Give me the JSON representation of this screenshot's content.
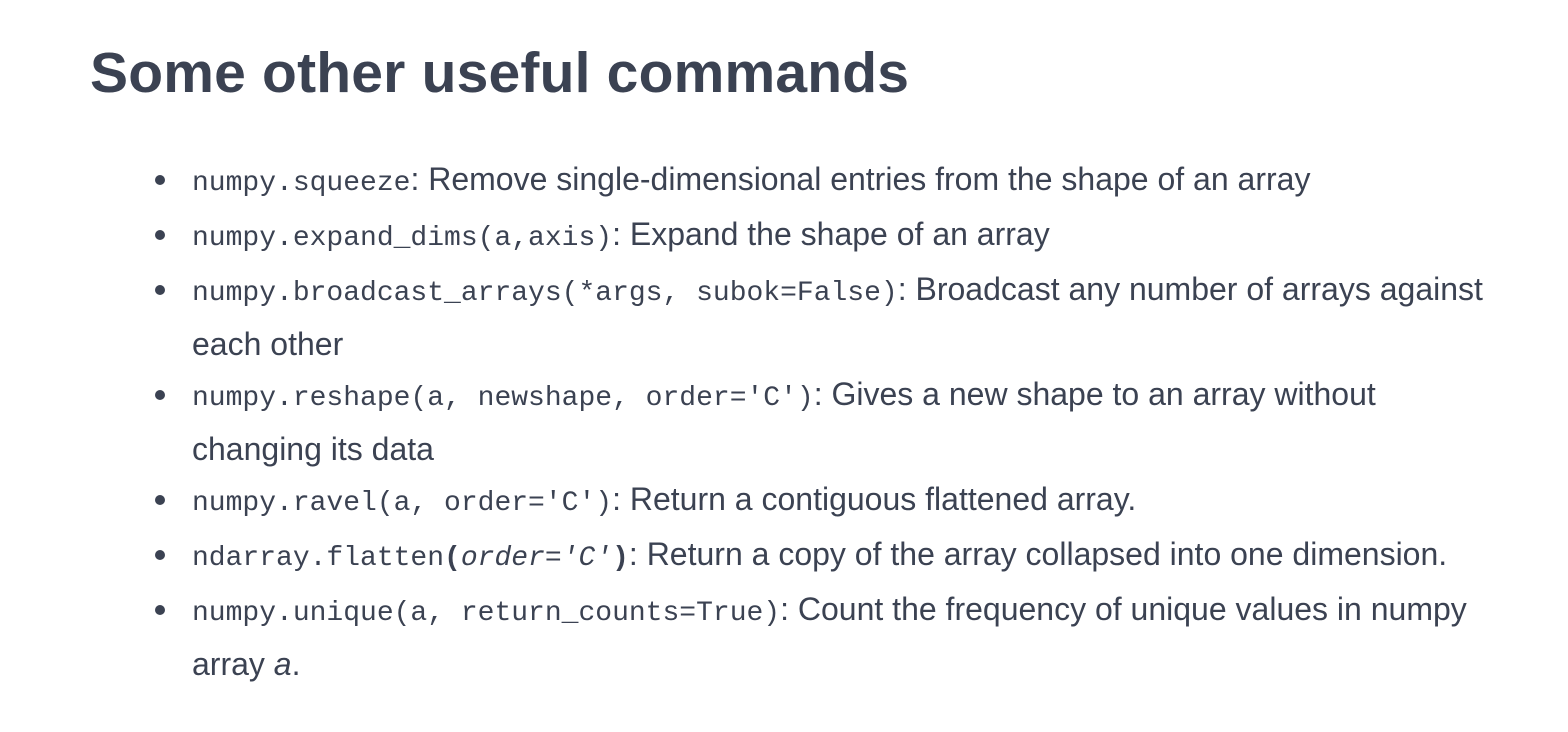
{
  "title": "Some other useful commands",
  "items": [
    {
      "code": "numpy.squeeze",
      "desc": ": Remove single-dimensional entries from the shape of an array"
    },
    {
      "code": "numpy.expand_dims(a,axis)",
      "desc": ": Expand the shape of an array"
    },
    {
      "code": "numpy.broadcast_arrays(*args, subok=False)",
      "desc": ": Broadcast any number of arrays against each other"
    },
    {
      "code": "numpy.reshape(a, newshape, order='C')",
      "desc": ": Gives a new shape to an array without changing its data"
    },
    {
      "code": "numpy.ravel(a, order='C')",
      "desc": ": Return a contiguous flattened array."
    },
    {
      "code_name": "ndarray.flatten",
      "code_open": "(",
      "code_args": "order='C'",
      "code_close": ")",
      "desc": ": Return a copy of the array collapsed into one dimension."
    },
    {
      "code": "numpy.unique(a, return_counts=True)",
      "desc": ": Count the frequency of unique values in numpy array ",
      "desc_var": "a",
      "desc_end": "."
    }
  ]
}
